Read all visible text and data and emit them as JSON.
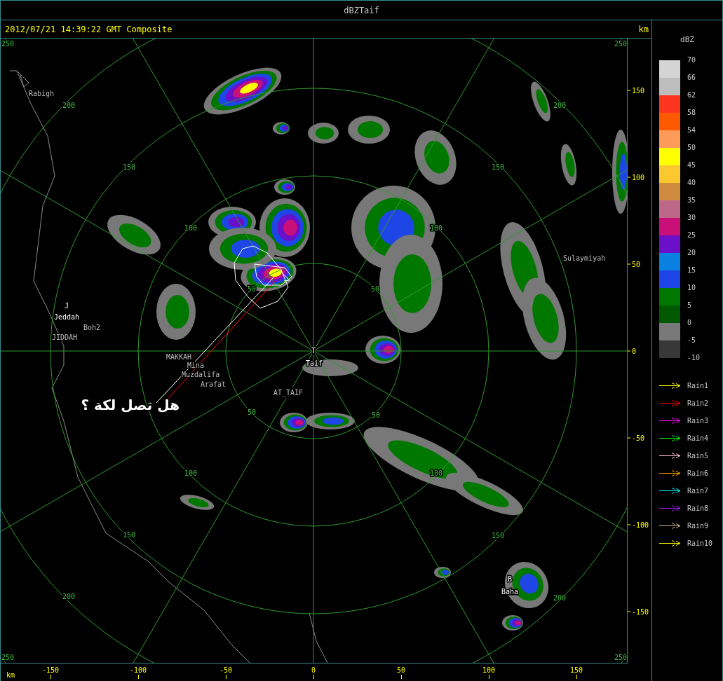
{
  "window": {
    "title": "dBZTaif"
  },
  "header": {
    "timestamp": "2012/07/21 14:39:22 GMT Composite",
    "unit": "km"
  },
  "map": {
    "ring_labels": [
      "250",
      "200",
      "150",
      "100",
      "50",
      "50",
      "100",
      "150",
      "200",
      "250",
      "50",
      "100",
      "150",
      "200",
      "250",
      "50",
      "100",
      "150",
      "200",
      "250"
    ],
    "places": [
      {
        "label": "Rabigh",
        "kind": "place"
      },
      {
        "label": "J",
        "kind": "site"
      },
      {
        "label": "Jeddah",
        "kind": "site"
      },
      {
        "label": "Boh2",
        "kind": "place"
      },
      {
        "label": "JIDDAH",
        "kind": "place"
      },
      {
        "label": "MAKKAH",
        "kind": "place"
      },
      {
        "label": "Mina",
        "kind": "place"
      },
      {
        "label": "Muzdalifa",
        "kind": "place"
      },
      {
        "label": "Arafat",
        "kind": "place"
      },
      {
        "label": "AT_TAIF",
        "kind": "place"
      },
      {
        "label": "T",
        "kind": "site"
      },
      {
        "label": "Taif",
        "kind": "site"
      },
      {
        "label": "Sulaymiyah",
        "kind": "place"
      },
      {
        "label": "B",
        "kind": "site"
      },
      {
        "label": "Baha",
        "kind": "site"
      }
    ],
    "annotation": "هل تصل لكة ؟"
  },
  "y_axis": {
    "ticks": [
      "150",
      "100",
      "50",
      "0",
      "-50",
      "-100",
      "-150"
    ]
  },
  "x_axis": {
    "unit": "km",
    "ticks": [
      "-150",
      "-100",
      "-50",
      "0",
      "50",
      "100",
      "150"
    ]
  },
  "legend": {
    "title": "dBZ",
    "bands": [
      {
        "color": "#d4d4d4"
      },
      {
        "color": "#bdbdbd"
      },
      {
        "color": "#ff3520"
      },
      {
        "color": "#ff5a00"
      },
      {
        "color": "#ff9a5a"
      },
      {
        "color": "#ffff00"
      },
      {
        "color": "#fbc830"
      },
      {
        "color": "#d08a40"
      },
      {
        "color": "#be6888"
      },
      {
        "color": "#c81078"
      },
      {
        "color": "#6a10c8"
      },
      {
        "color": "#0a80e0"
      },
      {
        "color": "#1e46e6"
      },
      {
        "color": "#007800"
      },
      {
        "color": "#005800"
      },
      {
        "color": "#787878"
      },
      {
        "color": "#383838"
      }
    ],
    "ticks": [
      "70",
      "66",
      "62",
      "58",
      "54",
      "50",
      "45",
      "40",
      "35",
      "30",
      "25",
      "20",
      "15",
      "10",
      "5",
      "0",
      "-5",
      "-10"
    ],
    "tracks": [
      {
        "label": "Rain1",
        "color": "#ffff00"
      },
      {
        "label": "Rain2",
        "color": "#ff0000"
      },
      {
        "label": "Rain3",
        "color": "#ff00ff"
      },
      {
        "label": "Rain4",
        "color": "#00ff00"
      },
      {
        "label": "Rain5",
        "color": "#ffc0cb"
      },
      {
        "label": "Rain6",
        "color": "#ffa500"
      },
      {
        "label": "Rain7",
        "color": "#00ffff"
      },
      {
        "label": "Rain8",
        "color": "#a020f0"
      },
      {
        "label": "Rain9",
        "color": "#d2b48c"
      },
      {
        "label": "Rain10",
        "color": "#ffff00"
      }
    ]
  }
}
